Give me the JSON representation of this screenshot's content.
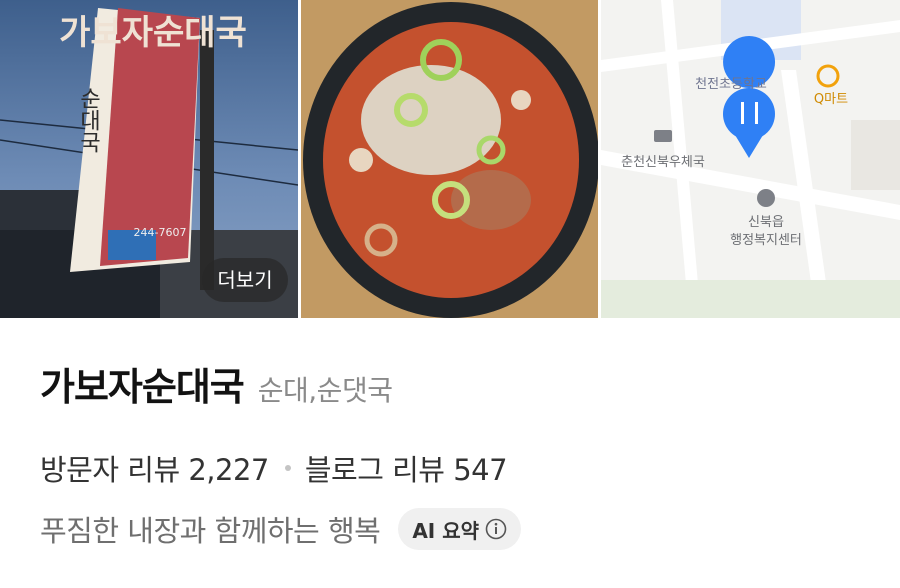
{
  "gallery": {
    "sign_text": "가보자순대국",
    "sign_vertical": "순대국",
    "sign_phone": "244-7607",
    "more_label": "더보기"
  },
  "map": {
    "labels": {
      "school": "천전초등학교",
      "mart": "Q마트",
      "post": "춘천신북우체국",
      "center_line1": "신북읍",
      "center_line2": "행정복지센터"
    },
    "pin_color": "#2f80f5",
    "mart_icon_color": "#f2a20c"
  },
  "place": {
    "name": "가보자순대국",
    "category": "순대,순댓국",
    "visitor_review": "방문자 리뷰 2,227",
    "blog_review": "블로그 리뷰 547",
    "summary": "푸짐한 내장과 함께하는 행복",
    "ai_summary_label": "AI 요약"
  }
}
